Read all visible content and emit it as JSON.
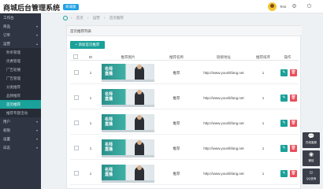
{
  "header": {
    "brand": "商城后台管理系统",
    "badge": "商城版",
    "username": "Test",
    "icons": [
      "user-avatar",
      "settings-icon",
      "logout-icon"
    ]
  },
  "sidebar": {
    "items": [
      {
        "label": "工作台",
        "type": "top"
      },
      {
        "label": "商品",
        "type": "top",
        "arrow": "▾"
      },
      {
        "label": "订单",
        "type": "top",
        "arrow": "▾"
      },
      {
        "label": "运营",
        "type": "top",
        "arrow": "▴"
      },
      {
        "label": "秒杀管理",
        "type": "sub"
      },
      {
        "label": "优惠管理",
        "type": "sub"
      },
      {
        "label": "广告轮播",
        "type": "sub"
      },
      {
        "label": "广告管理",
        "type": "sub"
      },
      {
        "label": "分类推荐",
        "type": "sub"
      },
      {
        "label": "品牌推荐",
        "type": "sub"
      },
      {
        "label": "首页推荐",
        "type": "sub-active"
      },
      {
        "label": "推荐专题活动",
        "type": "sub"
      },
      {
        "label": "用户",
        "type": "top",
        "arrow": "▾"
      },
      {
        "label": "权限",
        "type": "top",
        "arrow": "▾"
      },
      {
        "label": "设置",
        "type": "top",
        "arrow": "▾"
      },
      {
        "label": "日志",
        "type": "top",
        "arrow": "▾"
      }
    ]
  },
  "breadcrumb": [
    "首页",
    "运营",
    "首页推荐"
  ],
  "panel": {
    "title": "首页推荐列表",
    "add_button": "+ 添加首页推荐",
    "columns": [
      "",
      "ID",
      "推荐图片",
      "推荐名称",
      "链接地址",
      "推荐排序",
      "操作"
    ],
    "rows": [
      {
        "id": "1",
        "name": "推荐",
        "url": "http://www.youshifang.net",
        "sort": "1"
      },
      {
        "id": "1",
        "name": "推荐",
        "url": "http://www.youshifang.net",
        "sort": "1"
      },
      {
        "id": "1",
        "name": "推荐",
        "url": "http://www.youshifang.net",
        "sort": "1"
      },
      {
        "id": "1",
        "name": "推荐",
        "url": "http://www.youshifang.net",
        "sort": "1"
      },
      {
        "id": "1",
        "name": "推荐",
        "url": "http://www.youshifang.net",
        "sort": "1"
      }
    ],
    "banner_text": "名师\n直播",
    "edit_icon": "✎",
    "delete_icon": "🗑"
  },
  "float": [
    {
      "icon": "chat-bubble-icon",
      "glyph": "💬",
      "label": "在线客服"
    },
    {
      "icon": "wechat-icon",
      "glyph": "◉",
      "label": "微信"
    },
    {
      "icon": "qq-icon",
      "glyph": "☺",
      "label": "QQ咨询"
    }
  ],
  "colors": {
    "sidebar_bg": "#2f3542",
    "accent": "#1aa19a",
    "danger": "#e84f5b",
    "badge": "#1da1e6"
  }
}
